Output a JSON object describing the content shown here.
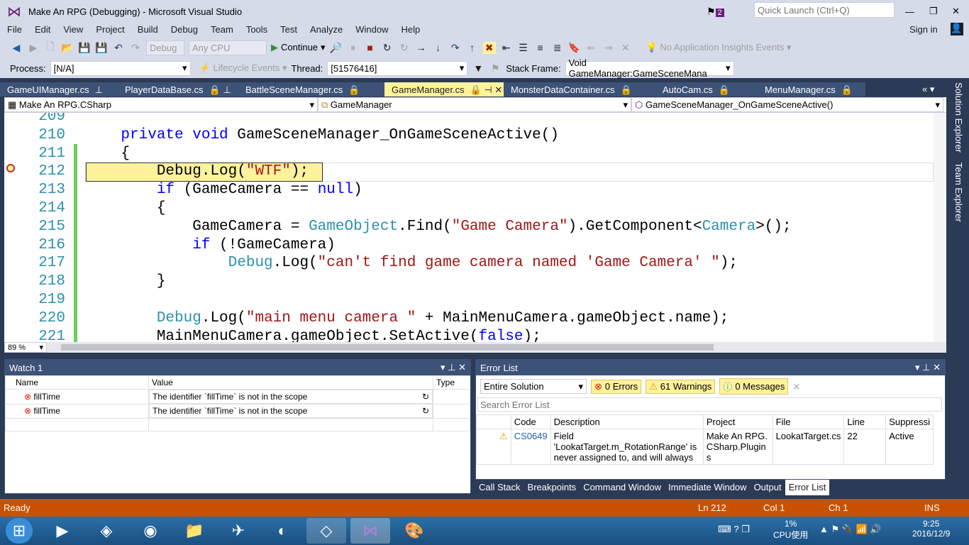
{
  "title": "Make An RPG (Debugging) - Microsoft Visual Studio",
  "notifications_count": "2",
  "quick_launch_placeholder": "Quick Launch (Ctrl+Q)",
  "sign_in": "Sign in",
  "menu": [
    "File",
    "Edit",
    "View",
    "Project",
    "Build",
    "Debug",
    "Team",
    "Tools",
    "Test",
    "Analyze",
    "Window",
    "Help"
  ],
  "toolbar": {
    "config": "Debug",
    "platform": "Any CPU",
    "continue": "Continue",
    "insights": "No Application Insights Events"
  },
  "debug_location": {
    "process_label": "Process:",
    "process": "[N/A]",
    "lifecycle": "Lifecycle Events",
    "thread_label": "Thread:",
    "thread": "[51576416]",
    "stack_label": "Stack Frame:",
    "stack": "Void GameManager:GameSceneMana"
  },
  "tabs": [
    "GameUIManager.cs",
    "PlayerDataBase.cs",
    "BattleSceneManager.cs",
    "GameManager.cs",
    "MonsterDataContainer.cs",
    "AutoCam.cs",
    "MenuManager.cs"
  ],
  "active_tab": 3,
  "nav": {
    "project": "Make An RPG.CSharp",
    "type": "GameManager",
    "member": "GameSceneManager_OnGameSceneActive()"
  },
  "side_tabs": [
    "Solution Explorer",
    "Team Explorer"
  ],
  "code": [
    {
      "n": "209",
      "t": []
    },
    {
      "n": "210",
      "t": [
        [
          "    ",
          ""
        ],
        [
          "private",
          "kw"
        ],
        [
          " ",
          ""
        ],
        [
          "void",
          "kw"
        ],
        [
          " GameSceneManager_OnGameSceneActive()",
          ""
        ]
      ]
    },
    {
      "n": "211",
      "t": [
        [
          "    {",
          ""
        ]
      ]
    },
    {
      "n": "212",
      "t": [
        [
          "        Debug.Log(",
          ""
        ],
        [
          "\"WTF\"",
          "st"
        ],
        [
          ");",
          ""
        ]
      ]
    },
    {
      "n": "213",
      "t": [
        [
          "        ",
          ""
        ],
        [
          "if",
          "kw"
        ],
        [
          " (GameCamera == ",
          ""
        ],
        [
          "null",
          "kw"
        ],
        [
          ")",
          ""
        ]
      ]
    },
    {
      "n": "214",
      "t": [
        [
          "        {",
          ""
        ]
      ]
    },
    {
      "n": "215",
      "t": [
        [
          "            GameCamera = ",
          ""
        ],
        [
          "GameObject",
          "ty"
        ],
        [
          ".Find(",
          ""
        ],
        [
          "\"Game Camera\"",
          "st"
        ],
        [
          ").GetComponent<",
          ""
        ],
        [
          "Camera",
          "ty"
        ],
        [
          ">();",
          ""
        ]
      ]
    },
    {
      "n": "216",
      "t": [
        [
          "            ",
          ""
        ],
        [
          "if",
          "kw"
        ],
        [
          " (!GameCamera)",
          ""
        ]
      ]
    },
    {
      "n": "217",
      "t": [
        [
          "                ",
          ""
        ],
        [
          "Debug",
          "ty"
        ],
        [
          ".Log(",
          ""
        ],
        [
          "\"can't find game camera named 'Game Camera' \"",
          "st"
        ],
        [
          ");",
          ""
        ]
      ]
    },
    {
      "n": "218",
      "t": [
        [
          "        }",
          ""
        ]
      ]
    },
    {
      "n": "219",
      "t": []
    },
    {
      "n": "220",
      "t": [
        [
          "        ",
          ""
        ],
        [
          "Debug",
          "ty"
        ],
        [
          ".Log(",
          ""
        ],
        [
          "\"main menu camera \"",
          "st"
        ],
        [
          " + MainMenuCamera.gameObject.name);",
          ""
        ]
      ]
    },
    {
      "n": "221",
      "t": [
        [
          "        MainMenuCamera.gameObject.SetActive(",
          ""
        ],
        [
          "false",
          "kw"
        ],
        [
          ");",
          ""
        ]
      ]
    }
  ],
  "zoom": "89 %",
  "watch": {
    "title": "Watch 1",
    "columns": [
      "Name",
      "Value",
      "Type"
    ],
    "rows": [
      {
        "name": "fillTime",
        "value": "The identifier `fillTime` is not in the scope"
      },
      {
        "name": "fillTime",
        "value": "The identifier `fillTime` is not in the scope"
      }
    ]
  },
  "errors": {
    "title": "Error List",
    "scope": "Entire Solution",
    "errors": "0 Errors",
    "warnings": "61 Warnings",
    "messages": "0 Messages",
    "search_placeholder": "Search Error List",
    "columns": [
      "Code",
      "Description",
      "Project",
      "File",
      "Line",
      "Suppressi"
    ],
    "rows": [
      {
        "code": "CS0649",
        "description": "Field 'LookatTarget.m_RotationRange' is never assigned to, and will always",
        "project": "Make An RPG.CSharp.Plugins",
        "file": "LookatTarget.cs",
        "line": "22",
        "suppression": "Active"
      }
    ]
  },
  "bottom_tabs": [
    "Call Stack",
    "Breakpoints",
    "Command Window",
    "Immediate Window",
    "Output",
    "Error List"
  ],
  "status": {
    "state": "Ready",
    "ln": "Ln 212",
    "col": "Col 1",
    "ch": "Ch 1",
    "mode": "INS"
  },
  "tray": {
    "cpu": "1%",
    "cpu_label": "CPU使用",
    "time": "9:25",
    "date": "2016/12/9"
  },
  "colors": {
    "accent": "#68217a",
    "status": "#ca5100",
    "current_line": "#fff29d"
  }
}
